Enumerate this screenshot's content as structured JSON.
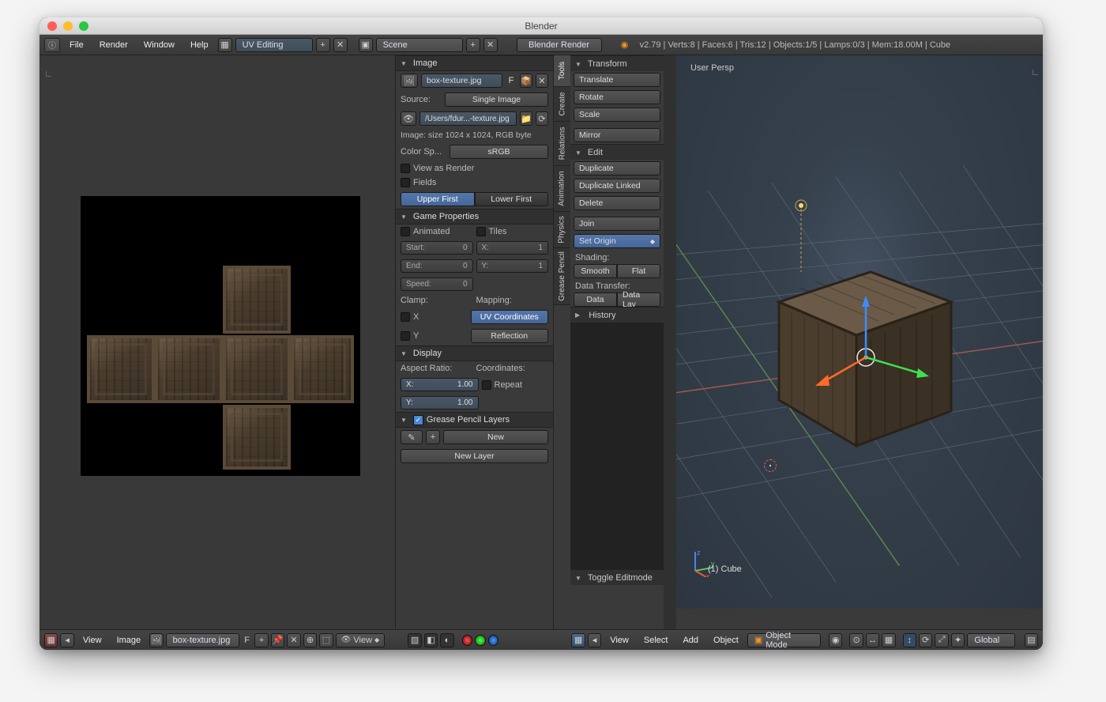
{
  "window_title": "Blender",
  "menubar": {
    "items": [
      "File",
      "Render",
      "Window",
      "Help"
    ],
    "layout": "UV Editing",
    "scene": "Scene",
    "engine": "Blender Render",
    "stats": "v2.79 | Verts:8 | Faces:6 | Tris:12 | Objects:1/5 | Lamps:0/3 | Mem:18.00M | Cube"
  },
  "props": {
    "image_panel": {
      "title": "Image",
      "file": "box-texture.jpg",
      "flag": "F",
      "source_label": "Source:",
      "source_value": "Single Image",
      "path": "/Users/fdur...-texture.jpg",
      "info": "Image: size 1024 x 1024, RGB byte",
      "color_space_label": "Color Sp...",
      "color_space_value": "sRGB",
      "view_as_render": "View as Render",
      "fields": "Fields",
      "upper": "Upper First",
      "lower": "Lower First"
    },
    "game": {
      "title": "Game Properties",
      "animated": "Animated",
      "tiles": "Tiles",
      "start_label": "Start:",
      "start_val": "0",
      "end_label": "End:",
      "end_val": "0",
      "speed_label": "Speed:",
      "speed_val": "0",
      "x_label": "X:",
      "x_val": "1",
      "y_label": "Y:",
      "y_val": "1",
      "clamp_label": "Clamp:",
      "clamp_x": "X",
      "clamp_y": "Y",
      "mapping_label": "Mapping:",
      "mapping_uv": "UV Coordinates",
      "mapping_refl": "Reflection"
    },
    "display": {
      "title": "Display",
      "aspect_label": "Aspect Ratio:",
      "ax_label": "X:",
      "ax_val": "1.00",
      "ay_label": "Y:",
      "ay_val": "1.00",
      "coords_label": "Coordinates:",
      "repeat": "Repeat"
    },
    "grease": {
      "title": "Grease Pencil Layers",
      "new": "New",
      "new_layer": "New Layer"
    }
  },
  "tabs": [
    "Tools",
    "Create",
    "Relations",
    "Animation",
    "Physics",
    "Grease Pencil"
  ],
  "actions": {
    "transform": {
      "title": "Transform",
      "items": [
        "Translate",
        "Rotate",
        "Scale"
      ],
      "mirror": "Mirror"
    },
    "edit": {
      "title": "Edit",
      "duplicate": "Duplicate",
      "duplicate_linked": "Duplicate Linked",
      "delete": "Delete",
      "join": "Join",
      "set_origin": "Set Origin",
      "shading_label": "Shading:",
      "smooth": "Smooth",
      "flat": "Flat",
      "data_transfer_label": "Data Transfer:",
      "data": "Data",
      "data_lay": "Data Lay"
    },
    "history": {
      "title": "History"
    },
    "toggle": {
      "title": "Toggle Editmode"
    }
  },
  "viewport": {
    "persp": "User Persp",
    "object": "(1) Cube"
  },
  "footer_uv": {
    "menus": [
      "View",
      "Image"
    ],
    "file": "box-texture.jpg",
    "flag": "F",
    "view_btn": "View"
  },
  "footer_3d": {
    "menus": [
      "View",
      "Select",
      "Add",
      "Object"
    ],
    "mode": "Object Mode",
    "orient": "Global"
  }
}
